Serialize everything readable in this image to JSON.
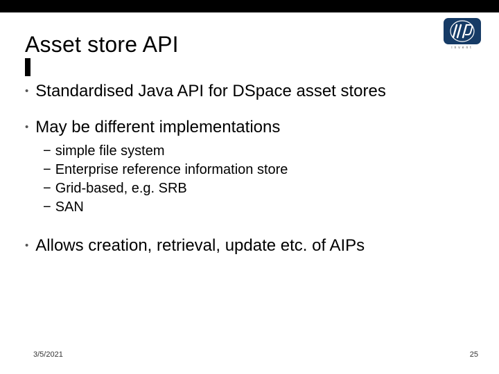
{
  "title": "Asset store API",
  "logo_caption": "invent",
  "bullets": {
    "b1": "Standardised Java API for DSpace asset stores",
    "b2": "May be different implementations",
    "b2_sub": {
      "s1": "simple file system",
      "s2": "Enterprise reference information store",
      "s3": "Grid-based, e.g. SRB",
      "s4": "SAN"
    },
    "b3": "Allows creation, retrieval, update etc. of AIPs"
  },
  "footer": {
    "date": "3/5/2021",
    "page": "25"
  }
}
